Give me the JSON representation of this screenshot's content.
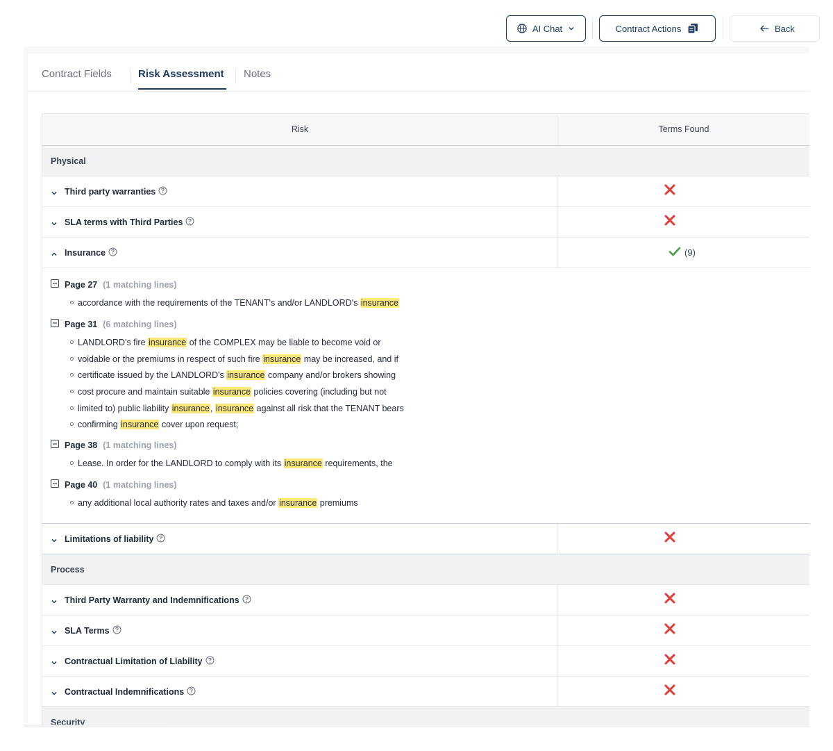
{
  "header": {
    "ai_chat_label": "AI Chat",
    "contract_actions_label": "Contract Actions",
    "back_label": "Back"
  },
  "tabs": [
    {
      "label": "Contract Fields",
      "active": false
    },
    {
      "label": "Risk Assessment",
      "active": true
    },
    {
      "label": "Notes",
      "active": false
    }
  ],
  "table": {
    "columns": [
      "Risk",
      "Terms Found"
    ],
    "categories": [
      {
        "name": "Physical"
      },
      {
        "name": "Process"
      },
      {
        "name": "Security"
      }
    ],
    "rows": [
      {
        "label": "Third party warranties",
        "found": false
      },
      {
        "label": "SLA terms with Third Parties",
        "found": false
      },
      {
        "label": "Insurance",
        "found": true,
        "count": "(9)",
        "expanded": true
      },
      {
        "label": "Limitations of liability",
        "found": false
      },
      {
        "label": "Third Party Warranty and Indemnifications",
        "found": false
      },
      {
        "label": "SLA Terms",
        "found": false
      },
      {
        "label": "Contractual Limitation of Liability",
        "found": false
      },
      {
        "label": "Contractual Indemnifications",
        "found": false
      }
    ]
  },
  "insurance_matches": [
    {
      "page": "Page 27",
      "count_label": "(1 matching lines)",
      "lines": [
        [
          "accordance with the requirements of the TENANT's and/or LANDLORD's ",
          "insurance",
          ""
        ]
      ]
    },
    {
      "page": "Page 31",
      "count_label": "(6 matching lines)",
      "lines": [
        [
          "LANDLORD's fire ",
          "insurance",
          " of the COMPLEX may be liable to become void or"
        ],
        [
          "voidable or the premiums in respect of such fire ",
          "insurance",
          " may be increased, and if"
        ],
        [
          "certificate issued by the LANDLORD's ",
          "insurance",
          " company and/or brokers showing"
        ],
        [
          "cost procure and maintain suitable ",
          "insurance",
          " policies covering (including but not"
        ],
        [
          "limited to) public liability ",
          "insurance",
          ", ",
          "insurance",
          " against all risk that the TENANT bears"
        ],
        [
          "confirming ",
          "insurance",
          " cover upon request;"
        ]
      ]
    },
    {
      "page": "Page 38",
      "count_label": "(1 matching lines)",
      "lines": [
        [
          "Lease. In order for the LANDLORD to comply with its ",
          "insurance",
          " requirements, the"
        ]
      ]
    },
    {
      "page": "Page 40",
      "count_label": "(1 matching lines)",
      "lines": [
        [
          "any additional local authority rates and taxes and/or ",
          "insurance",
          " premiums"
        ]
      ]
    }
  ],
  "colors": {
    "accent": "#1e3a5f",
    "highlight": "#fde776",
    "cross": "#e53935",
    "check": "#43a047"
  }
}
